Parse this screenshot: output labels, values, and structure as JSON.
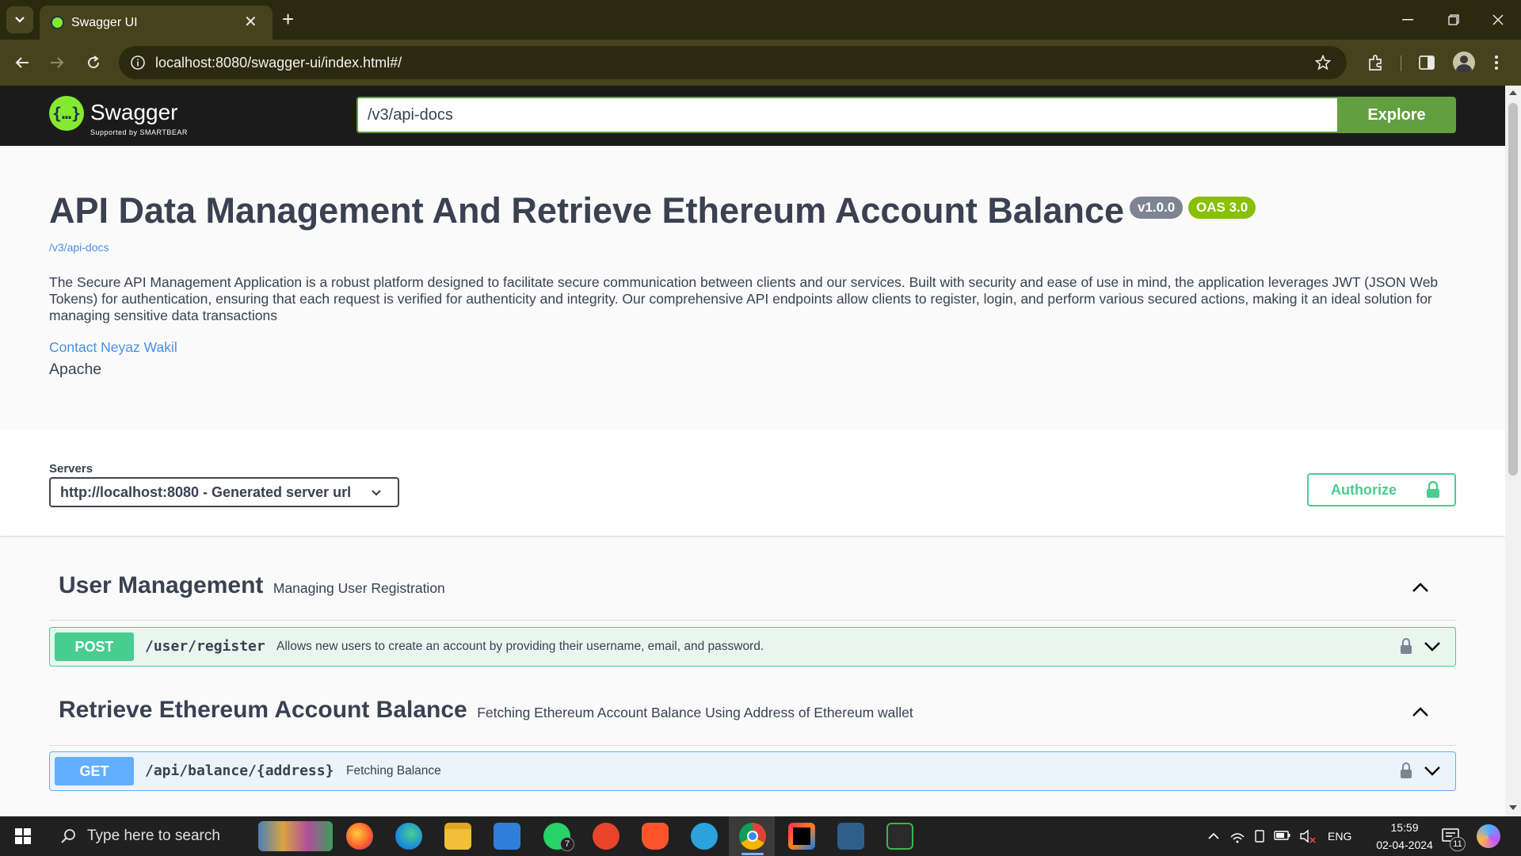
{
  "browser": {
    "tab_title": "Swagger UI",
    "tab_close": "✕",
    "new_tab": "+",
    "url": "localhost:8080/swagger-ui/index.html#/"
  },
  "swagger_topbar": {
    "logo_text": "Swagger",
    "logo_sub": "Supported by SMARTBEAR",
    "spec_url": "/v3/api-docs",
    "explore_label": "Explore"
  },
  "info": {
    "title": "API Data Management And Retrieve Ethereum Account Balance",
    "version_badge": "v1.0.0",
    "oas_badge": "OAS 3.0",
    "spec_link": "/v3/api-docs",
    "description": "The Secure API Management Application is a robust platform designed to facilitate secure communication between clients and our services. Built with security and ease of use in mind, the application leverages JWT (JSON Web Tokens) for authentication, ensuring that each request is verified for authenticity and integrity. Our comprehensive API endpoints allow clients to register, login, and perform various secured actions, making it an ideal solution for managing sensitive data transactions",
    "contact": "Contact Neyaz Wakil",
    "license": "Apache"
  },
  "servers": {
    "label": "Servers",
    "selected": "http://localhost:8080 - Generated server url",
    "authorize_label": "Authorize"
  },
  "tags": [
    {
      "name": "User Management",
      "description": "Managing User Registration",
      "operation": {
        "method": "POST",
        "path": "/user/register",
        "summary": "Allows new users to create an account by providing their username, email, and password."
      }
    },
    {
      "name": "Retrieve Ethereum Account Balance",
      "description": "Fetching Ethereum Account Balance Using Address of Ethereum wallet",
      "operation": {
        "method": "GET",
        "path": "/api/balance/{address}",
        "summary": "Fetching Balance"
      }
    }
  ],
  "taskbar": {
    "search_placeholder": "Type here to search",
    "whatsapp_badge": "7",
    "language": "ENG",
    "time": "15:59",
    "date": "02-04-2024",
    "notification_count": "11"
  },
  "colors": {
    "post": "#49cc90",
    "get": "#61affe",
    "explore": "#62a03f",
    "swagger_green": "#85ea2d"
  }
}
